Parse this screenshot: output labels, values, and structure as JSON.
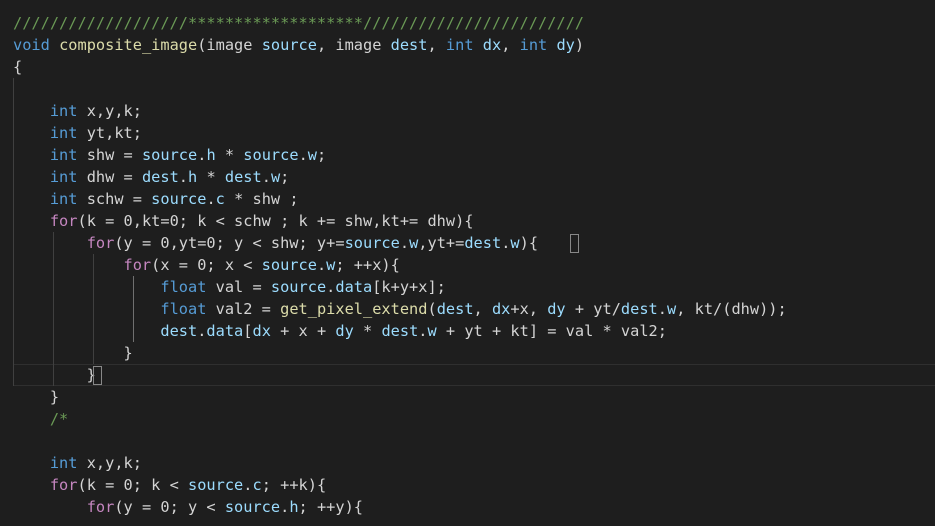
{
  "editor": {
    "theme": {
      "background": "#1e1e1e",
      "comment": "#6a9955",
      "keyword": "#569cd6",
      "control": "#c586c0",
      "function": "#dcdcaa",
      "variable": "#9cdcfe",
      "text": "#d4d4d4"
    },
    "lines": [
      [
        [
          "c",
          "///////////////////*******************////////////////////////"
        ]
      ],
      [
        [
          "k",
          "void"
        ],
        [
          "t",
          " "
        ],
        [
          "f",
          "composite_image"
        ],
        [
          "t",
          "(image "
        ],
        [
          "v",
          "source"
        ],
        [
          "t",
          ", image "
        ],
        [
          "v",
          "dest"
        ],
        [
          "t",
          ", "
        ],
        [
          "k",
          "int"
        ],
        [
          "t",
          " "
        ],
        [
          "v",
          "dx"
        ],
        [
          "t",
          ", "
        ],
        [
          "k",
          "int"
        ],
        [
          "t",
          " "
        ],
        [
          "v",
          "dy"
        ],
        [
          "t",
          ")"
        ]
      ],
      [
        [
          "t",
          "{"
        ]
      ],
      [],
      [
        [
          "t",
          "    "
        ],
        [
          "k",
          "int"
        ],
        [
          "t",
          " x,y,k;"
        ]
      ],
      [
        [
          "t",
          "    "
        ],
        [
          "k",
          "int"
        ],
        [
          "t",
          " yt,kt;"
        ]
      ],
      [
        [
          "t",
          "    "
        ],
        [
          "k",
          "int"
        ],
        [
          "t",
          " shw = "
        ],
        [
          "v",
          "source"
        ],
        [
          "t",
          "."
        ],
        [
          "v",
          "h"
        ],
        [
          "t",
          " * "
        ],
        [
          "v",
          "source"
        ],
        [
          "t",
          "."
        ],
        [
          "v",
          "w"
        ],
        [
          "t",
          ";"
        ]
      ],
      [
        [
          "t",
          "    "
        ],
        [
          "k",
          "int"
        ],
        [
          "t",
          " dhw = "
        ],
        [
          "v",
          "dest"
        ],
        [
          "t",
          "."
        ],
        [
          "v",
          "h"
        ],
        [
          "t",
          " * "
        ],
        [
          "v",
          "dest"
        ],
        [
          "t",
          "."
        ],
        [
          "v",
          "w"
        ],
        [
          "t",
          ";"
        ]
      ],
      [
        [
          "t",
          "    "
        ],
        [
          "k",
          "int"
        ],
        [
          "t",
          " schw = "
        ],
        [
          "v",
          "source"
        ],
        [
          "t",
          "."
        ],
        [
          "v",
          "c"
        ],
        [
          "t",
          " * shw ;"
        ]
      ],
      [
        [
          "t",
          "    "
        ],
        [
          "p",
          "for"
        ],
        [
          "t",
          "(k = 0,kt=0; k < schw ; k += shw,kt+= dhw){"
        ]
      ],
      [
        [
          "t",
          "        "
        ],
        [
          "p",
          "for"
        ],
        [
          "t",
          "(y = 0,yt=0; y < shw; y+="
        ],
        [
          "v",
          "source"
        ],
        [
          "t",
          "."
        ],
        [
          "v",
          "w"
        ],
        [
          "t",
          ",yt+="
        ],
        [
          "v",
          "dest"
        ],
        [
          "t",
          "."
        ],
        [
          "v",
          "w"
        ],
        [
          "t",
          "){"
        ]
      ],
      [
        [
          "t",
          "            "
        ],
        [
          "p",
          "for"
        ],
        [
          "t",
          "(x = 0; x < "
        ],
        [
          "v",
          "source"
        ],
        [
          "t",
          "."
        ],
        [
          "v",
          "w"
        ],
        [
          "t",
          "; ++x){"
        ]
      ],
      [
        [
          "t",
          "                "
        ],
        [
          "k",
          "float"
        ],
        [
          "t",
          " val = "
        ],
        [
          "v",
          "source"
        ],
        [
          "t",
          "."
        ],
        [
          "v",
          "data"
        ],
        [
          "t",
          "[k+y+x];"
        ]
      ],
      [
        [
          "t",
          "                "
        ],
        [
          "k",
          "float"
        ],
        [
          "t",
          " val2 = "
        ],
        [
          "f",
          "get_pixel_extend"
        ],
        [
          "t",
          "("
        ],
        [
          "v",
          "dest"
        ],
        [
          "t",
          ", "
        ],
        [
          "v",
          "dx"
        ],
        [
          "t",
          "+x, "
        ],
        [
          "v",
          "dy"
        ],
        [
          "t",
          " + yt/"
        ],
        [
          "v",
          "dest"
        ],
        [
          "t",
          "."
        ],
        [
          "v",
          "w"
        ],
        [
          "t",
          ", kt/(dhw));"
        ]
      ],
      [
        [
          "t",
          "                "
        ],
        [
          "v",
          "dest"
        ],
        [
          "t",
          "."
        ],
        [
          "v",
          "data"
        ],
        [
          "t",
          "["
        ],
        [
          "v",
          "dx"
        ],
        [
          "t",
          " + x + "
        ],
        [
          "v",
          "dy"
        ],
        [
          "t",
          " * "
        ],
        [
          "v",
          "dest"
        ],
        [
          "t",
          "."
        ],
        [
          "v",
          "w"
        ],
        [
          "t",
          " + yt + kt] = val * val2;"
        ]
      ],
      [
        [
          "t",
          "            }"
        ]
      ],
      [
        [
          "t",
          "        }"
        ]
      ],
      [
        [
          "t",
          "    }"
        ]
      ],
      [
        [
          "t",
          "    "
        ],
        [
          "c",
          "/*"
        ]
      ],
      [],
      [
        [
          "t",
          "    "
        ],
        [
          "k",
          "int"
        ],
        [
          "t",
          " x,y,k;"
        ]
      ],
      [
        [
          "t",
          "    "
        ],
        [
          "p",
          "for"
        ],
        [
          "t",
          "(k = 0; k < "
        ],
        [
          "v",
          "source"
        ],
        [
          "t",
          "."
        ],
        [
          "v",
          "c"
        ],
        [
          "t",
          "; ++k){"
        ]
      ],
      [
        [
          "t",
          "        "
        ],
        [
          "p",
          "for"
        ],
        [
          "t",
          "(y = 0; y < "
        ],
        [
          "v",
          "source"
        ],
        [
          "t",
          "."
        ],
        [
          "v",
          "h"
        ],
        [
          "t",
          "; ++y){"
        ]
      ]
    ]
  }
}
